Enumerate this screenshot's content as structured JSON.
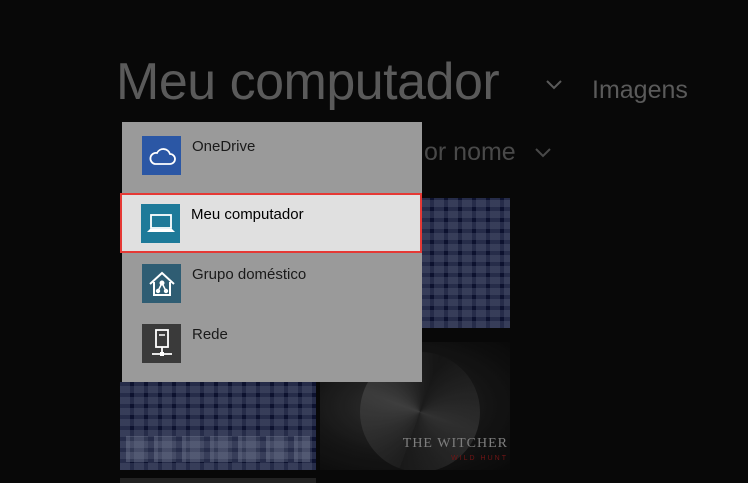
{
  "page": {
    "title": "Meu computador",
    "breadcrumb": "Imagens",
    "sort_label": "or nome"
  },
  "menu": {
    "items": [
      {
        "label": "OneDrive",
        "icon": "cloud-icon",
        "tile_color": "#2b57a5"
      },
      {
        "label": "Meu computador",
        "icon": "laptop-icon",
        "tile_color": "#1e7a99",
        "selected": true
      },
      {
        "label": "Grupo doméstico",
        "icon": "homegroup-icon",
        "tile_color": "#2f5d73"
      },
      {
        "label": "Rede",
        "icon": "network-icon",
        "tile_color": "#3a3a3a"
      }
    ]
  },
  "thumbnails": {
    "witcher_logo": "THE WITCHER",
    "witcher_sub": "WILD HUNT"
  },
  "colors": {
    "background": "#0a0a0a",
    "menu_background": "#9a9a9a",
    "selected_background": "#e0e0e0",
    "highlight_border": "#e53935"
  }
}
